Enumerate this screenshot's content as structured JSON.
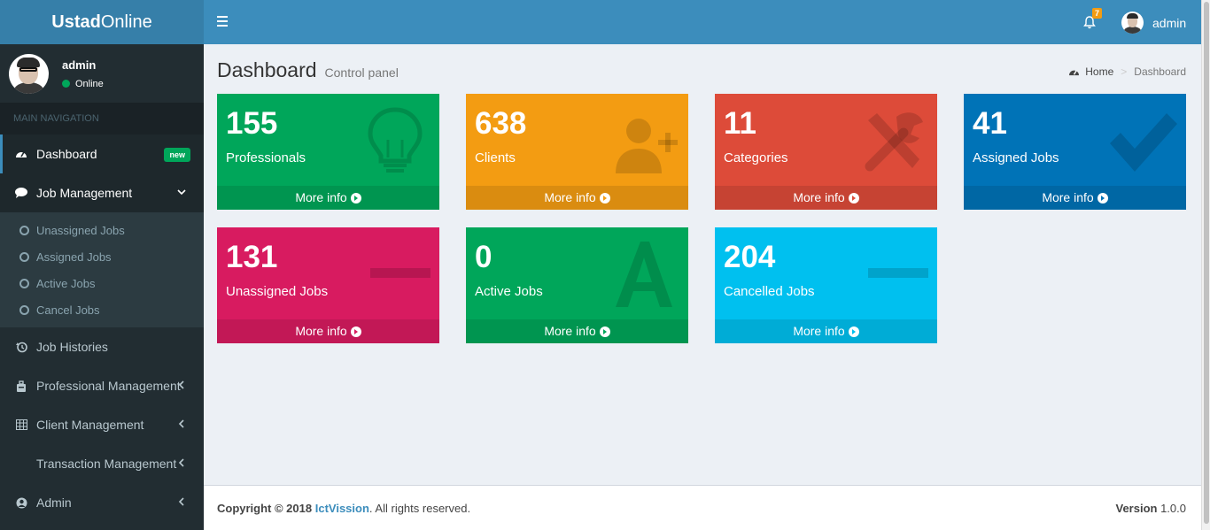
{
  "app": {
    "logo_bold": "Ustad",
    "logo_rest": "Online"
  },
  "user": {
    "name": "admin",
    "status": "Online"
  },
  "topbar": {
    "notification_count": "7",
    "user_name": "admin"
  },
  "sidebar": {
    "header": "MAIN NAVIGATION",
    "items": [
      {
        "label": "Dashboard",
        "icon": "dashboard-icon",
        "badge": "new"
      },
      {
        "label": "Job Management",
        "icon": "comment-icon"
      },
      {
        "label": "Job Histories",
        "icon": "history-icon"
      },
      {
        "label": "Professional Management",
        "icon": "briefcase-icon"
      },
      {
        "label": "Client Management",
        "icon": "table-icon"
      },
      {
        "label": "Transaction Management",
        "icon": ""
      },
      {
        "label": "Admin",
        "icon": "user-circle-icon"
      }
    ],
    "submenu": [
      {
        "label": "Unassigned Jobs"
      },
      {
        "label": "Assigned Jobs"
      },
      {
        "label": "Active Jobs"
      },
      {
        "label": "Cancel Jobs"
      }
    ]
  },
  "content": {
    "title": "Dashboard",
    "subtitle": "Control panel",
    "breadcrumb": {
      "home": "Home",
      "current": "Dashboard"
    }
  },
  "boxes": [
    {
      "value": "155",
      "label": "Professionals",
      "footer": "More info",
      "color": "#00a65a",
      "icon": "lightbulb-icon"
    },
    {
      "value": "638",
      "label": "Clients",
      "footer": "More info",
      "color": "#f39c12",
      "icon": "user-plus-icon"
    },
    {
      "value": "11",
      "label": "Categories",
      "footer": "More info",
      "color": "#dd4b39",
      "icon": "tools-icon"
    },
    {
      "value": "41",
      "label": "Assigned Jobs",
      "footer": "More info",
      "color": "#0073b7",
      "icon": "check-icon"
    },
    {
      "value": "131",
      "label": "Unassigned Jobs",
      "footer": "More info",
      "color": "#d81b60",
      "icon": "minus-icon"
    },
    {
      "value": "0",
      "label": "Active Jobs",
      "footer": "More info",
      "color": "#00a65a",
      "icon": "letter-a-icon"
    },
    {
      "value": "204",
      "label": "Cancelled Jobs",
      "footer": "More info",
      "color": "#00c0ef",
      "icon": "minus-icon"
    }
  ],
  "footer": {
    "copyright": "Copyright © 2018",
    "company": "IctVission",
    "rights": ". All rights reserved.",
    "version_label": "Version",
    "version": "1.0.0"
  }
}
